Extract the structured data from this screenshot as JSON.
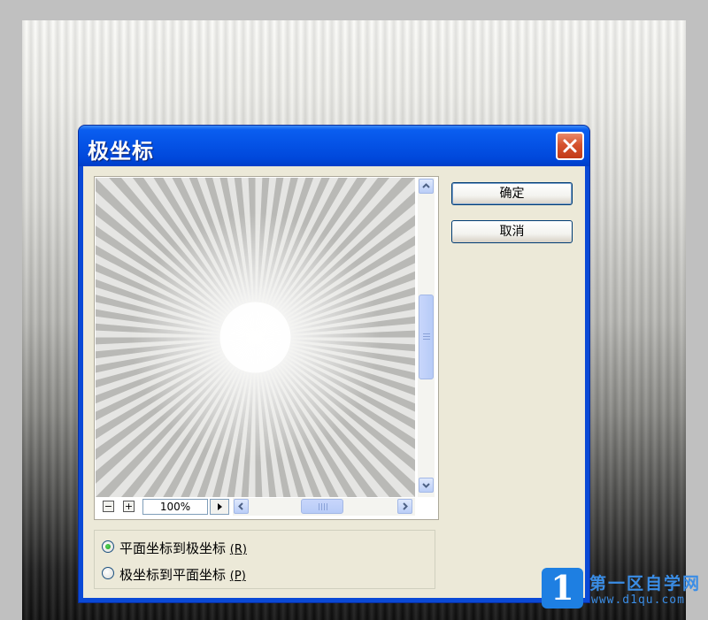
{
  "dialog": {
    "title": "极坐标",
    "ok_label": "确定",
    "cancel_label": "取消"
  },
  "preview": {
    "zoom_value": "100%",
    "zoom_out_glyph": "−",
    "zoom_in_glyph": "+"
  },
  "options": [
    {
      "label": "平面坐标到极坐标",
      "key": "(R)",
      "selected": true
    },
    {
      "label": "极坐标到平面坐标",
      "key": "(P)",
      "selected": false
    }
  ],
  "watermark": {
    "logo": "1",
    "name": "第一区自学网",
    "url": "www.d1qu.com"
  },
  "colors": {
    "titlebar": "#0553e6",
    "dialog_face": "#ece9d8",
    "close_button": "#d5522d",
    "watermark": "#3a8de6"
  }
}
